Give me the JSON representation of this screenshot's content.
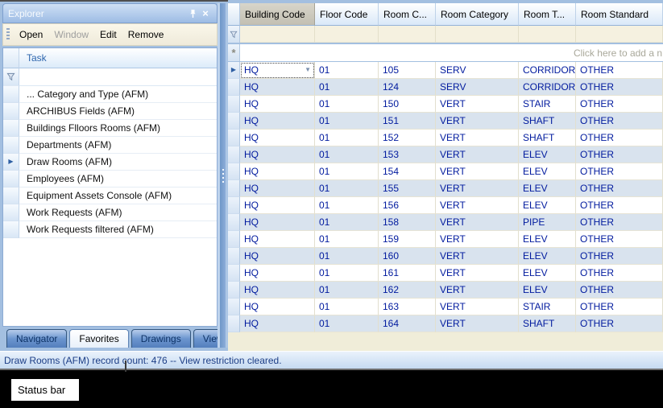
{
  "explorer": {
    "title": "Explorer",
    "menu": [
      {
        "label": "Open",
        "enabled": true
      },
      {
        "label": "Window",
        "enabled": false
      },
      {
        "label": "Edit",
        "enabled": true
      },
      {
        "label": "Remove",
        "enabled": true
      }
    ],
    "task_header": "Task",
    "tasks": [
      "... Category and Type (AFM)",
      "ARCHIBUS Fields (AFM)",
      "Buildings Flloors Rooms (AFM)",
      "Departments (AFM)",
      "Draw Rooms (AFM)",
      "Employees (AFM)",
      "Equipment Assets Console (AFM)",
      "Work Requests (AFM)",
      "Work Requests filtered (AFM)"
    ],
    "selected_task": "Draw Rooms (AFM)",
    "tabs": [
      {
        "label": "Navigator",
        "active": false
      },
      {
        "label": "Favorites",
        "active": true
      },
      {
        "label": "Drawings",
        "active": false
      },
      {
        "label": "Views",
        "active": false
      }
    ]
  },
  "grid": {
    "columns": [
      "Building Code",
      "Floor Code",
      "Room C...",
      "Room Category",
      "Room T...",
      "Room Standard"
    ],
    "selected_column": "Building Code",
    "add_row_text": "Click here to add a n",
    "selected_row_index": 0,
    "rows": [
      [
        "HQ",
        "01",
        "105",
        "SERV",
        "CORRIDOR",
        "OTHER"
      ],
      [
        "HQ",
        "01",
        "124",
        "SERV",
        "CORRIDOR",
        "OTHER"
      ],
      [
        "HQ",
        "01",
        "150",
        "VERT",
        "STAIR",
        "OTHER"
      ],
      [
        "HQ",
        "01",
        "151",
        "VERT",
        "SHAFT",
        "OTHER"
      ],
      [
        "HQ",
        "01",
        "152",
        "VERT",
        "SHAFT",
        "OTHER"
      ],
      [
        "HQ",
        "01",
        "153",
        "VERT",
        "ELEV",
        "OTHER"
      ],
      [
        "HQ",
        "01",
        "154",
        "VERT",
        "ELEV",
        "OTHER"
      ],
      [
        "HQ",
        "01",
        "155",
        "VERT",
        "ELEV",
        "OTHER"
      ],
      [
        "HQ",
        "01",
        "156",
        "VERT",
        "ELEV",
        "OTHER"
      ],
      [
        "HQ",
        "01",
        "158",
        "VERT",
        "PIPE",
        "OTHER"
      ],
      [
        "HQ",
        "01",
        "159",
        "VERT",
        "ELEV",
        "OTHER"
      ],
      [
        "HQ",
        "01",
        "160",
        "VERT",
        "ELEV",
        "OTHER"
      ],
      [
        "HQ",
        "01",
        "161",
        "VERT",
        "ELEV",
        "OTHER"
      ],
      [
        "HQ",
        "01",
        "162",
        "VERT",
        "ELEV",
        "OTHER"
      ],
      [
        "HQ",
        "01",
        "163",
        "VERT",
        "STAIR",
        "OTHER"
      ],
      [
        "HQ",
        "01",
        "164",
        "VERT",
        "SHAFT",
        "OTHER"
      ]
    ]
  },
  "status_bar": {
    "text": "Draw Rooms (AFM) record count: 476  --  View restriction cleared."
  },
  "annotation": {
    "label": "Status bar"
  },
  "icons": {
    "filter": "funnel",
    "pin": "pushpin",
    "close": "×",
    "row_marker": "▶",
    "dropdown": "▼",
    "add_row": "*"
  },
  "colors": {
    "window_background": "#a3bfe0",
    "toolbar_tan": "#f1edda",
    "grid_text_navy": "#001a9e",
    "alt_row_blue": "#d9e3ee",
    "selected_header_gray": "#c9c6b9",
    "status_text": "#1c3e86",
    "annotation_background": "#ffffff",
    "footer_black": "#000000"
  }
}
